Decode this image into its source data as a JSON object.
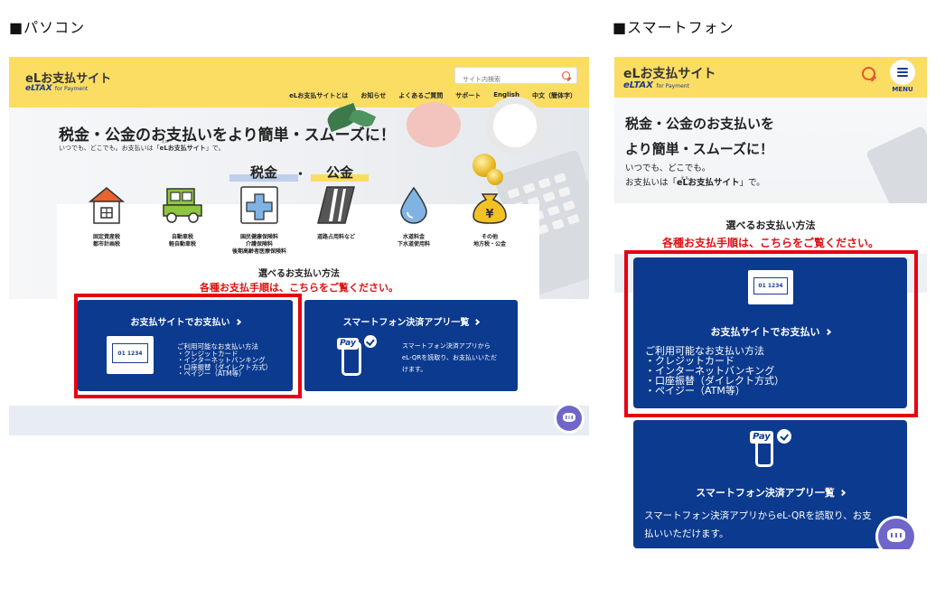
{
  "captions": {
    "pc": "■パソコン",
    "sp": "■スマートフォン"
  },
  "logo": {
    "main": "eLお支払サイト",
    "sub": "eLTAX",
    "sub_small": "for Payment"
  },
  "pc": {
    "search_placeholder": "サイト内検索",
    "nav": [
      "eLお支払サイトとは",
      "お知らせ",
      "よくあるご質問",
      "サポート",
      "English",
      "中文（簡体字）"
    ],
    "headline": "税金・公金のお支払いをより簡単・スムーズに！",
    "subline_pre": "いつでも、どこでも。お支払いは「",
    "subline_em": "eLお支払サイト",
    "subline_post": "」で。",
    "tag_tax": "税金",
    "tag_dot": "・",
    "tag_public": "公金",
    "categories": [
      {
        "l1": "固定資産税",
        "l2": "都市計画税",
        "l3": ""
      },
      {
        "l1": "自動車税",
        "l2": "軽自動車税",
        "l3": ""
      },
      {
        "l1": "国民健康保険料",
        "l2": "介護保険料",
        "l3": "後期高齢者医療保険料"
      },
      {
        "l1": "道路占用料など",
        "l2": "",
        "l3": ""
      },
      {
        "l1": "水道料金",
        "l2": "下水道使用料",
        "l3": ""
      },
      {
        "l1": "その他",
        "l2": "地方税・公金",
        "l3": ""
      }
    ],
    "methods_heading": "選べるお支払い方法",
    "methods_note": "各種お支払手順は、こちらをご覧ください。",
    "card1": {
      "title": "お支払サイトでお支払い",
      "screen": "01 1234",
      "list_title": "ご利用可能なお支払い方法",
      "items": [
        "・クレジットカード",
        "・インターネットバンキング",
        "・口座振替（ダイレクト方式）",
        "・ペイジー（ATM等）"
      ]
    },
    "card2": {
      "title": "スマートフォン決済アプリ一覧",
      "pay_label": "Pay",
      "desc": [
        "スマートフォン決済アプリから",
        "eL-QRを読取り、お支払いいただ",
        "けます。"
      ]
    }
  },
  "sp": {
    "menu_label": "MENU",
    "headline": [
      "税金・公金のお支払いを",
      "より簡単・スムーズに！"
    ],
    "subline1": "いつでも、どこでも。",
    "subline2_pre": "お支払いは「",
    "subline2_em": "eLお支払サイト",
    "subline2_post": "」で。",
    "methods_heading": "選べるお支払い方法",
    "methods_note": "各種お支払手順は、こちらをご覧ください。",
    "card1": {
      "title": "お支払サイトでお支払い",
      "screen": "01 1234",
      "list_title": "ご利用可能なお支払い方法",
      "items": [
        "・クレジットカード",
        "・インターネットバンキング",
        "・口座振替（ダイレクト方式）",
        "・ペイジー（ATM等）"
      ]
    },
    "card2": {
      "title": "スマートフォン決済アプリ一覧",
      "pay_label": "Pay",
      "desc": [
        "スマートフォン決済アプリからeL-QRを読取り、お支",
        "払いいただけます。"
      ]
    }
  },
  "colors": {
    "header": "#fbdd63",
    "card": "#0b3a8f",
    "highlight": "#e60012",
    "note": "#dd1111",
    "chat": "#6f66c9"
  },
  "icons": [
    "house-icon",
    "car-icon",
    "medical-cross-icon",
    "road-icon",
    "water-drop-icon",
    "coin-bag-icon",
    "search-icon",
    "menu-icon",
    "monitor-icon",
    "smartphone-pay-icon",
    "chat-icon"
  ]
}
